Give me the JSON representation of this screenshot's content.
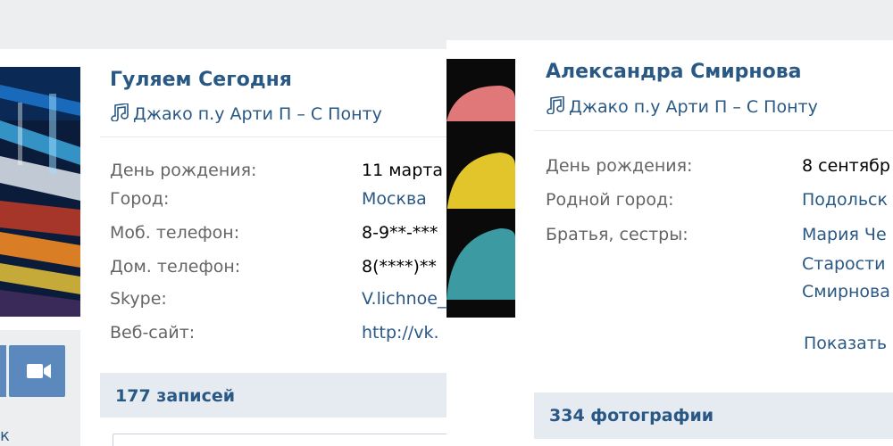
{
  "left_profile": {
    "name": "Гуляем Сегодня",
    "status_icon": "music-note-icon",
    "status": "Джако п.у Арти П – С Понту",
    "info": [
      {
        "label": "День рождения:",
        "value": "11 марта"
      },
      {
        "label": "Город:",
        "value": "Москва"
      },
      {
        "label": "Моб. телефон:",
        "value": "8-9**-***"
      },
      {
        "label": "Дом. телефон:",
        "value": "8(****)**"
      },
      {
        "label": "Skype:",
        "value": "V.lichnoe_"
      },
      {
        "label": "Веб-сайт:",
        "value": "http://vk."
      }
    ],
    "posts_count": "177 записей",
    "video_icon": "video-camera-icon"
  },
  "right_profile": {
    "name": "Александра Смирнова",
    "status_icon": "music-note-icon",
    "status": "Джако п.у Арти П – С Понту",
    "info": [
      {
        "label": "День рождения:",
        "value": "8 сентябр"
      },
      {
        "label": "Родной город:",
        "value": "Подольск"
      },
      {
        "label": "Братья, сестры:",
        "value": "Мария Че"
      }
    ],
    "siblings_more": [
      "Старости",
      "Смирнова"
    ],
    "show_more": "Показать",
    "photos_count": "334 фотографии"
  },
  "colors": {
    "link": "#2a5885",
    "label": "#656565",
    "page_bg": "#edeef0",
    "bar_bg": "#e5ebf1",
    "button": "#5b88bd"
  }
}
